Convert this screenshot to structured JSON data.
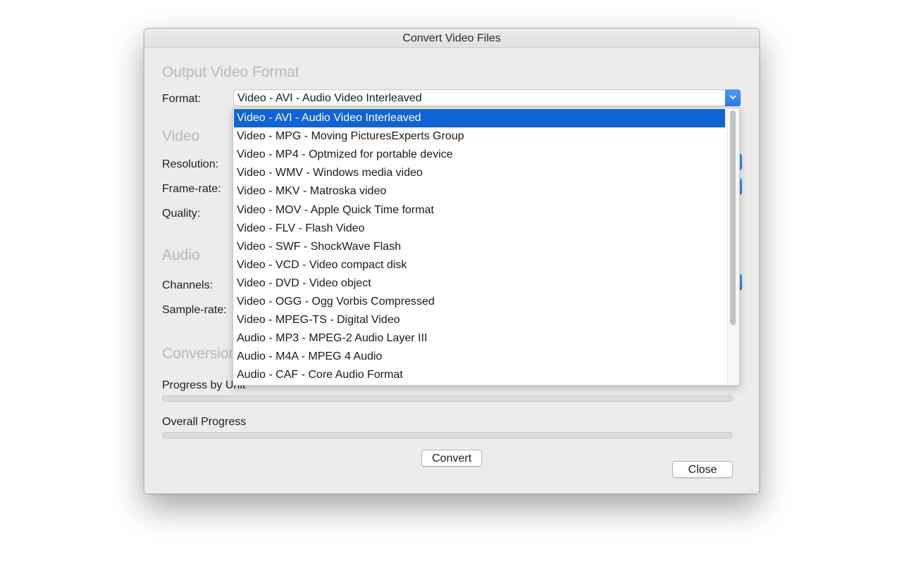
{
  "window": {
    "title": "Convert Video Files"
  },
  "sections": {
    "output": "Output Video Format",
    "video": "Video",
    "audio": "Audio",
    "conversion": "Conversion"
  },
  "labels": {
    "format": "Format:",
    "resolution": "Resolution:",
    "framerate": "Frame-rate:",
    "quality": "Quality:",
    "channels": "Channels:",
    "samplerate": "Sample-rate:",
    "progress_unit": "Progress by Unit",
    "progress_overall": "Overall Progress"
  },
  "format_select": {
    "selected": "Video - AVI - Audio Video Interleaved",
    "options": [
      "Video - AVI - Audio Video Interleaved",
      "Video - MPG - Moving PicturesExperts Group",
      "Video - MP4 - Optmized for portable device",
      "Video - WMV - Windows media video",
      "Video - MKV - Matroska video",
      "Video - MOV - Apple Quick Time format",
      "Video - FLV - Flash Video",
      "Video - SWF - ShockWave Flash",
      "Video - VCD - Video compact disk",
      "Video - DVD - Video object",
      "Video - OGG - Ogg Vorbis Compressed",
      "Video - MPEG-TS - Digital Video",
      "Audio - MP3 - MPEG-2 Audio Layer III",
      "Audio - M4A - MPEG 4 Audio",
      "Audio - CAF - Core Audio Format"
    ],
    "highlighted_index": 0
  },
  "progress": {
    "unit_percent": 0,
    "overall_percent": 0
  },
  "buttons": {
    "convert": "Convert",
    "close": "Close"
  },
  "colors": {
    "accent": "#0f63d6",
    "section_heading": "#b8b8b8"
  }
}
